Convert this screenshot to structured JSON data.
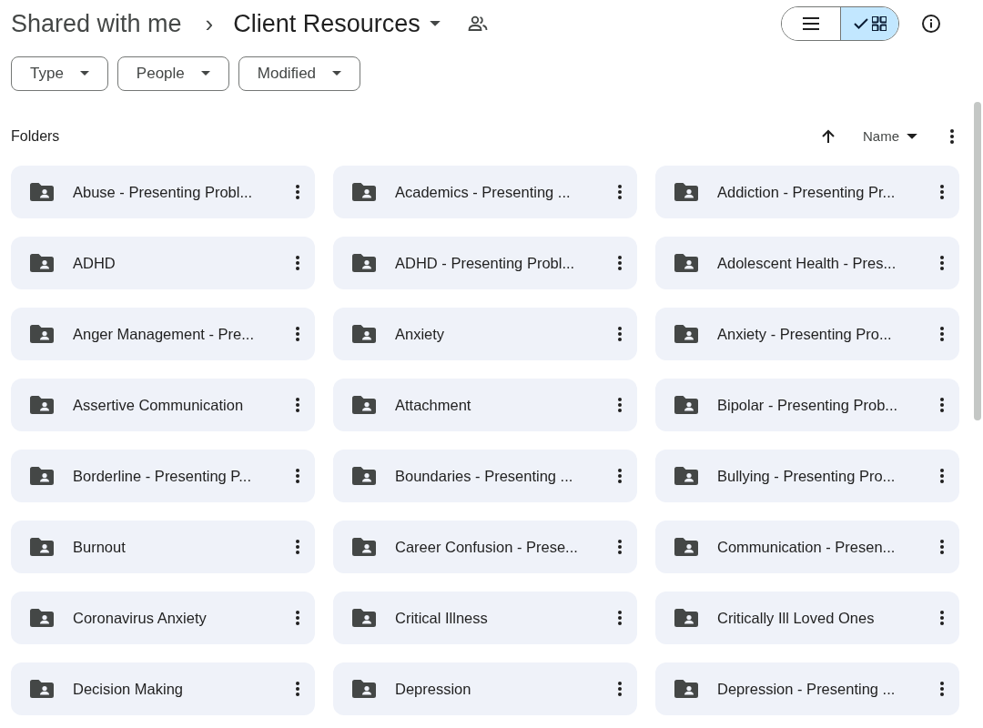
{
  "breadcrumb": {
    "parent": "Shared with me",
    "separator": "›",
    "current": "Client Resources"
  },
  "view_toggle": [
    {
      "kind": "list",
      "selected": false
    },
    {
      "kind": "grid",
      "selected": true
    }
  ],
  "filters": [
    {
      "label": "Type"
    },
    {
      "label": "People"
    },
    {
      "label": "Modified"
    }
  ],
  "section_title": "Folders",
  "sort": {
    "label": "Name"
  },
  "folders": [
    {
      "name": "Abuse - Presenting Probl..."
    },
    {
      "name": "Academics - Presenting ..."
    },
    {
      "name": "Addiction - Presenting Pr..."
    },
    {
      "name": "ADHD"
    },
    {
      "name": "ADHD - Presenting Probl..."
    },
    {
      "name": "Adolescent Health - Pres..."
    },
    {
      "name": "Anger Management - Pre..."
    },
    {
      "name": "Anxiety"
    },
    {
      "name": "Anxiety - Presenting Pro..."
    },
    {
      "name": "Assertive Communication"
    },
    {
      "name": "Attachment"
    },
    {
      "name": "Bipolar - Presenting Prob..."
    },
    {
      "name": "Borderline - Presenting P..."
    },
    {
      "name": "Boundaries - Presenting ..."
    },
    {
      "name": "Bullying - Presenting Pro..."
    },
    {
      "name": "Burnout"
    },
    {
      "name": "Career Confusion - Prese..."
    },
    {
      "name": "Communication - Presen..."
    },
    {
      "name": "Coronavirus Anxiety"
    },
    {
      "name": "Critical Illness"
    },
    {
      "name": "Critically Ill Loved Ones"
    },
    {
      "name": "Decision Making"
    },
    {
      "name": "Depression"
    },
    {
      "name": "Depression - Presenting ..."
    }
  ]
}
